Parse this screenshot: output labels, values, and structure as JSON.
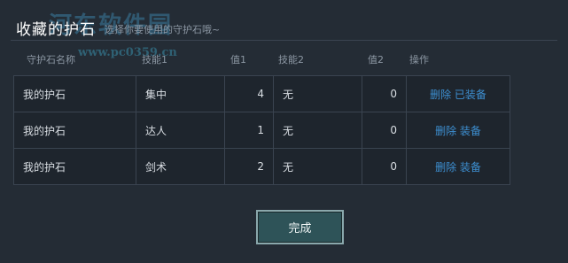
{
  "dialog": {
    "title": "收藏的护石",
    "subtitle": "选择你要使用的守护石哦~"
  },
  "watermark": {
    "text": "河东软件园",
    "url": "www.pc0359.cn"
  },
  "table": {
    "headers": [
      "守护石名称",
      "技能1",
      "值1",
      "技能2",
      "值2",
      "操作"
    ],
    "rows": [
      {
        "name": "我的护石",
        "skill1": "集中",
        "value1": "4",
        "skill2": "无",
        "value2": "0",
        "delete": "删除",
        "equip": "已装备"
      },
      {
        "name": "我的护石",
        "skill1": "达人",
        "value1": "1",
        "skill2": "无",
        "value2": "0",
        "delete": "删除",
        "equip": "装备"
      },
      {
        "name": "我的护石",
        "skill1": "剑术",
        "value1": "2",
        "skill2": "无",
        "value2": "0",
        "delete": "删除",
        "equip": "装备"
      }
    ]
  },
  "footer": {
    "done_label": "完成"
  },
  "colors": {
    "background": "#242c35",
    "table_bg": "#1e252d",
    "border": "#3a4450",
    "link": "#3d8fd1",
    "button_bg": "#2e5358",
    "button_border": "#8aa8ac"
  }
}
